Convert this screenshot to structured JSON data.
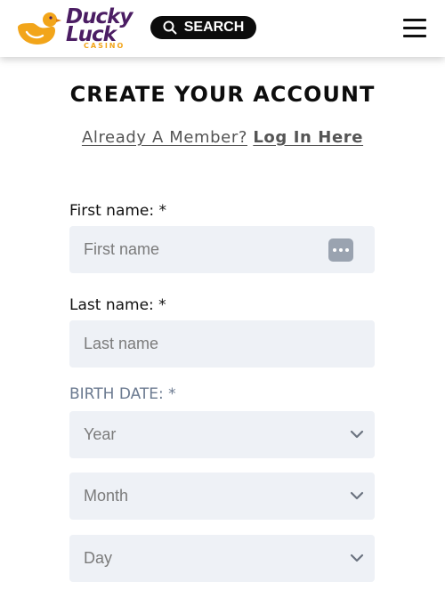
{
  "header": {
    "logo": {
      "line1": "Ducky",
      "line2": "Luck",
      "line3": "CASINO"
    },
    "search_label": "SEARCH",
    "menu_icon": "hamburger-icon"
  },
  "page": {
    "title": "CREATE YOUR ACCOUNT",
    "member_prefix": "Already A Member?",
    "login_link": "Log In Here"
  },
  "form": {
    "first_name": {
      "label": "First name: *",
      "placeholder": "First name"
    },
    "last_name": {
      "label": "Last name: *",
      "placeholder": "Last name"
    },
    "birth_date": {
      "label": "BIRTH DATE: *",
      "year": "Year",
      "month": "Month",
      "day": "Day"
    }
  },
  "colors": {
    "brand_purple": "#4b1d63",
    "brand_yellow": "#f2a51a",
    "input_bg": "#eef1f6"
  }
}
